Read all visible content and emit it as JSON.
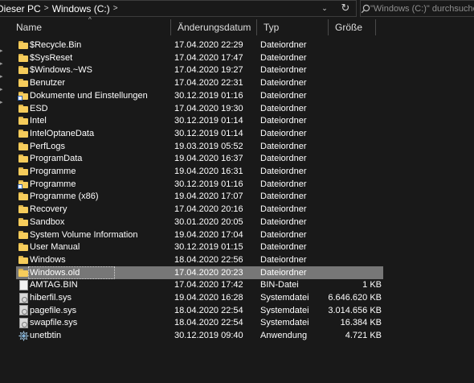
{
  "address": {
    "crumbs": [
      "Dieser PC",
      "Windows (C:)"
    ],
    "separator": ">",
    "dropdown": "⌄",
    "refresh": "↻"
  },
  "search": {
    "placeholder": "\"Windows (C:)\" durchsuchen"
  },
  "columns": {
    "name": "Name",
    "date": "Änderungsdatum",
    "type": "Typ",
    "size": "Größe",
    "sort_indicator": "^"
  },
  "colors": {
    "background": "#191919",
    "selected_row": "#777777",
    "folder": "#f6cc5b"
  },
  "files": [
    {
      "name": "$Recycle.Bin",
      "date": "17.04.2020 22:29",
      "type": "Dateiordner",
      "size": "",
      "icon": "folder-icon"
    },
    {
      "name": "$SysReset",
      "date": "17.04.2020 17:47",
      "type": "Dateiordner",
      "size": "",
      "icon": "folder-icon"
    },
    {
      "name": "$Windows.~WS",
      "date": "17.04.2020 19:27",
      "type": "Dateiordner",
      "size": "",
      "icon": "folder-icon"
    },
    {
      "name": "Benutzer",
      "date": "17.04.2020 22:31",
      "type": "Dateiordner",
      "size": "",
      "icon": "folder-icon"
    },
    {
      "name": "Dokumente und Einstellungen",
      "date": "30.12.2019 01:16",
      "type": "Dateiordner",
      "size": "",
      "icon": "folder-link-icon"
    },
    {
      "name": "ESD",
      "date": "17.04.2020 19:30",
      "type": "Dateiordner",
      "size": "",
      "icon": "folder-icon"
    },
    {
      "name": "Intel",
      "date": "30.12.2019 01:14",
      "type": "Dateiordner",
      "size": "",
      "icon": "folder-icon"
    },
    {
      "name": "IntelOptaneData",
      "date": "30.12.2019 01:14",
      "type": "Dateiordner",
      "size": "",
      "icon": "folder-icon"
    },
    {
      "name": "PerfLogs",
      "date": "19.03.2019 05:52",
      "type": "Dateiordner",
      "size": "",
      "icon": "folder-icon"
    },
    {
      "name": "ProgramData",
      "date": "19.04.2020 16:37",
      "type": "Dateiordner",
      "size": "",
      "icon": "folder-icon"
    },
    {
      "name": "Programme",
      "date": "19.04.2020 16:31",
      "type": "Dateiordner",
      "size": "",
      "icon": "folder-icon"
    },
    {
      "name": "Programme",
      "date": "30.12.2019 01:16",
      "type": "Dateiordner",
      "size": "",
      "icon": "folder-link-icon"
    },
    {
      "name": "Programme (x86)",
      "date": "19.04.2020 17:07",
      "type": "Dateiordner",
      "size": "",
      "icon": "folder-icon"
    },
    {
      "name": "Recovery",
      "date": "17.04.2020 20:16",
      "type": "Dateiordner",
      "size": "",
      "icon": "folder-icon"
    },
    {
      "name": "Sandbox",
      "date": "30.01.2020 20:05",
      "type": "Dateiordner",
      "size": "",
      "icon": "folder-icon"
    },
    {
      "name": "System Volume Information",
      "date": "19.04.2020 17:04",
      "type": "Dateiordner",
      "size": "",
      "icon": "folder-icon"
    },
    {
      "name": "User Manual",
      "date": "30.12.2019 01:15",
      "type": "Dateiordner",
      "size": "",
      "icon": "folder-icon"
    },
    {
      "name": "Windows",
      "date": "18.04.2020 22:56",
      "type": "Dateiordner",
      "size": "",
      "icon": "folder-icon"
    },
    {
      "name": "Windows.old",
      "date": "17.04.2020 20:23",
      "type": "Dateiordner",
      "size": "",
      "icon": "folder-icon",
      "selected": true
    },
    {
      "name": "AMTAG.BIN",
      "date": "17.04.2020 17:42",
      "type": "BIN-Datei",
      "size": "1 KB",
      "icon": "file-icon"
    },
    {
      "name": "hiberfil.sys",
      "date": "19.04.2020 16:28",
      "type": "Systemdatei",
      "size": "6.646.620 KB",
      "icon": "system-file-icon"
    },
    {
      "name": "pagefile.sys",
      "date": "18.04.2020 22:54",
      "type": "Systemdatei",
      "size": "3.014.656 KB",
      "icon": "system-file-icon"
    },
    {
      "name": "swapfile.sys",
      "date": "18.04.2020 22:54",
      "type": "Systemdatei",
      "size": "16.384 KB",
      "icon": "system-file-icon"
    },
    {
      "name": "unetbtin",
      "date": "30.12.2019 09:40",
      "type": "Anwendung",
      "size": "4.721 KB",
      "icon": "application-icon"
    }
  ]
}
